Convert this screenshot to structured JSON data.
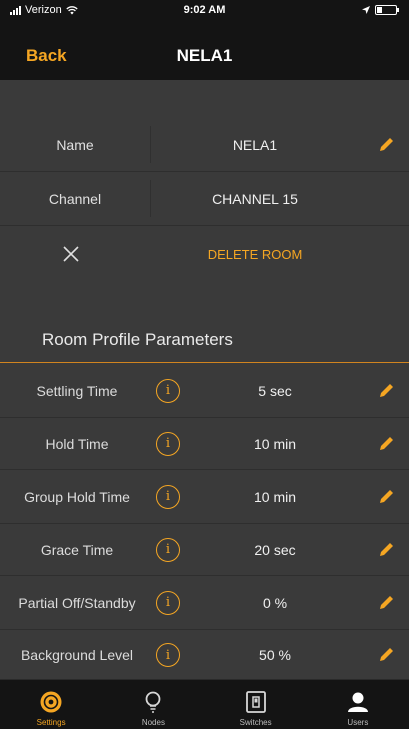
{
  "status": {
    "carrier": "Verizon",
    "time": "9:02 AM"
  },
  "nav": {
    "back_label": "Back",
    "title": "NELA1"
  },
  "room": {
    "name_label": "Name",
    "name_value": "NELA1",
    "channel_label": "Channel",
    "channel_value": "CHANNEL 15",
    "delete_label": "DELETE ROOM"
  },
  "section_title": "Room Profile Parameters",
  "params": [
    {
      "label": "Settling Time",
      "value": "5 sec"
    },
    {
      "label": "Hold Time",
      "value": "10 min"
    },
    {
      "label": "Group Hold Time",
      "value": "10 min"
    },
    {
      "label": "Grace Time",
      "value": "20 sec"
    },
    {
      "label": "Partial Off/Standby",
      "value": "0 %"
    },
    {
      "label": "Background Level",
      "value": "50 %"
    }
  ],
  "tabs": [
    {
      "label": "Settings",
      "icon": "gear-icon",
      "active": true
    },
    {
      "label": "Nodes",
      "icon": "bulb-icon",
      "active": false
    },
    {
      "label": "Switches",
      "icon": "switch-icon",
      "active": false
    },
    {
      "label": "Users",
      "icon": "user-icon",
      "active": false
    }
  ],
  "colors": {
    "accent": "#f5a623",
    "background": "#3a3a3a",
    "bar": "#141414"
  }
}
